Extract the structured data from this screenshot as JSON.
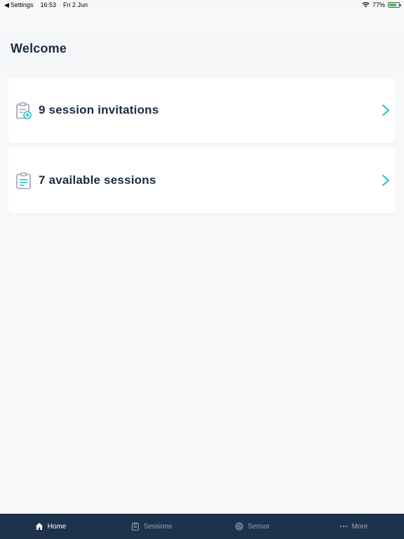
{
  "status_bar": {
    "back_label": "Settings",
    "time": "16:53",
    "date": "Fri 2 Jun",
    "battery": "77%",
    "battery_level": 0.77
  },
  "header": {
    "title": "Welcome"
  },
  "cards": [
    {
      "label": "9 session invitations",
      "icon": "clipboard-plus-icon"
    },
    {
      "label": "7 available sessions",
      "icon": "clipboard-list-icon"
    }
  ],
  "tabbar": {
    "items": [
      {
        "label": "Home",
        "icon": "home-icon",
        "active": true
      },
      {
        "label": "Sessions",
        "icon": "clipboard-icon",
        "active": false
      },
      {
        "label": "Sensor",
        "icon": "sensor-icon",
        "active": false
      },
      {
        "label": "More",
        "icon": "more-icon",
        "active": false
      }
    ]
  },
  "colors": {
    "accent": "#23c5c0",
    "navy": "#1b2a44",
    "tabbar_bg": "#1e324d",
    "background": "#f7f8fa"
  }
}
